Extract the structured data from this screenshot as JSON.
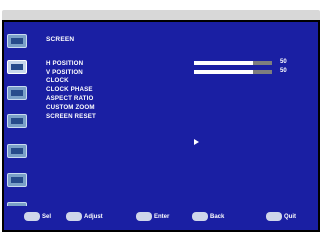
{
  "osd": {
    "title": "SCREEN",
    "items": [
      {
        "label": "H POSITION",
        "value": "50",
        "level": 0.75
      },
      {
        "label": "V POSITION",
        "value": "50",
        "level": 0.75
      },
      {
        "label": "CLOCK"
      },
      {
        "label": "CLOCK PHASE"
      },
      {
        "label": "ASPECT RATIO"
      },
      {
        "label": "CUSTOM ZOOM"
      },
      {
        "label": "SCREEN RESET"
      }
    ],
    "sidebar_icons": [
      "picture-icon",
      "screen-icon",
      "audio-icon",
      "schedule-icon",
      "osd-icon",
      "multi-input-icon",
      "advanced-icon"
    ],
    "footer": [
      {
        "label": "Sel",
        "icon": "select-key-icon"
      },
      {
        "label": "Adjust",
        "icon": "adjust-key-icon"
      },
      {
        "label": "Enter",
        "icon": "enter-key-icon"
      },
      {
        "label": "Back",
        "icon": "back-key-icon"
      },
      {
        "label": "Quit",
        "icon": "quit-key-icon"
      }
    ],
    "colors": {
      "background": "#1a1fa3",
      "text": "#ffffff",
      "slider_track": "#7e7e7e"
    }
  }
}
